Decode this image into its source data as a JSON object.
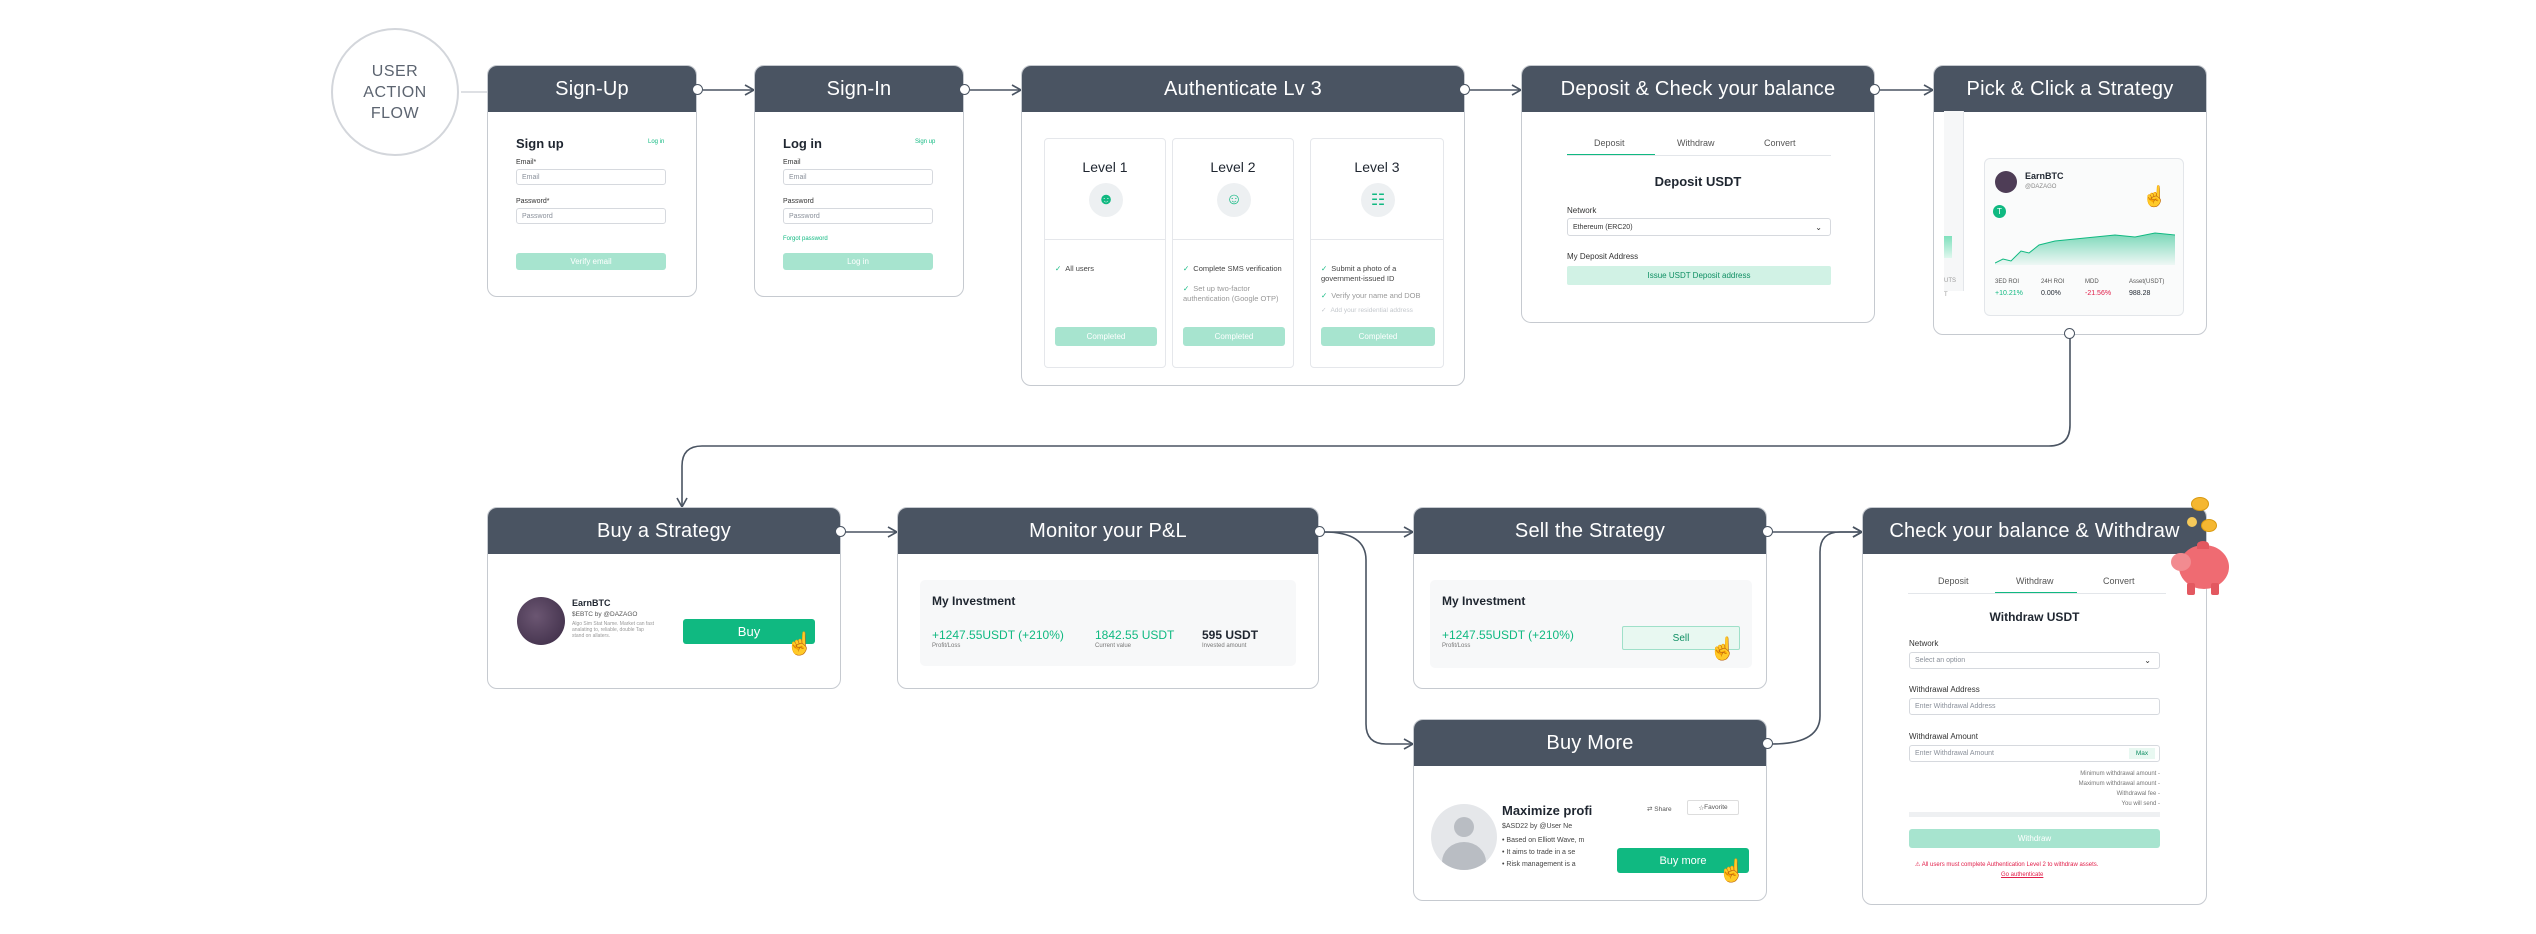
{
  "flow_label": [
    "USER",
    "ACTION",
    "FLOW"
  ],
  "colors": {
    "header": "#4a5462",
    "accent": "#10b981",
    "accent_pale": "#a7e4cf",
    "negative": "#e11d48",
    "arrow": "#4a5462"
  },
  "signup": {
    "header": "Sign-Up",
    "title": "Sign up",
    "login_link": "Log in",
    "email_label": "Email*",
    "email_placeholder": "Email",
    "password_label": "Password*",
    "password_placeholder": "Password",
    "button": "Verify email"
  },
  "signin": {
    "header": "Sign-In",
    "title": "Log in",
    "signup_link": "Sign up",
    "email_label": "Email",
    "email_placeholder": "Email",
    "password_label": "Password",
    "password_placeholder": "Password",
    "forgot": "Forgot password",
    "button": "Log in"
  },
  "authenticate": {
    "header": "Authenticate Lv 3",
    "levels": [
      {
        "title": "Level 1",
        "items": [
          "All users"
        ],
        "button": "Completed"
      },
      {
        "title": "Level 2",
        "items": [
          "Complete SMS verification",
          "Set up two-factor authentication (Google OTP)"
        ],
        "button": "Completed"
      },
      {
        "title": "Level  3",
        "items": [
          "Submit a photo of a government-issued ID",
          "Verify your name and DOB"
        ],
        "faded": "Add your residential address",
        "button": "Completed"
      }
    ]
  },
  "deposit": {
    "header": "Deposit & Check your balance",
    "tabs": [
      "Deposit",
      "Withdraw",
      "Convert"
    ],
    "title": "Deposit USDT",
    "network_label": "Network",
    "network_value": "Ethereum (ERC20)",
    "address_label": "My Deposit Address",
    "issue_button": "Issue USDT Deposit address"
  },
  "pick": {
    "header": "Pick & Click a Strategy",
    "name": "EarnBTC",
    "handle": "@DAZAGO",
    "badge": "T",
    "stats_labels": [
      "3ED ROI",
      "24H ROI",
      "MDD",
      "Asset(USDT)"
    ],
    "stats_values": [
      "+10.21%",
      "0.00%",
      "-21.56%",
      "988.28"
    ],
    "left_labels": [
      "UTS",
      "T"
    ]
  },
  "buy": {
    "header": "Buy a Strategy",
    "name": "EarnBTC",
    "sub": "$EBTC by @DAZAGO",
    "desc": "Algo Sim Stat Name. Market can fast analating to, reliable, double Tap stand on allaters.",
    "button": "Buy"
  },
  "monitor": {
    "header": "Monitor your P&L",
    "title": "My Investment",
    "pl_value": "+1247.55USDT (+210%)",
    "pl_label": "Profit/Loss",
    "current_value": "1842.55 USDT",
    "current_label": "Current value",
    "invested_value": "595 USDT",
    "invested_label": "Invested amount"
  },
  "sell": {
    "header": "Sell the Strategy",
    "title": "My Investment",
    "pl_value": "+1247.55USDT (+210%)",
    "pl_label": "Profit/Loss",
    "button": "Sell"
  },
  "buymore": {
    "header": "Buy More",
    "title": "Maximize profi",
    "sub": "$ASD22 by @User Ne",
    "bullets": [
      "Based on Elliott Wave, m",
      "It aims to trade in a se",
      "Risk management is a"
    ],
    "share": "Share",
    "favorite": "Favorite",
    "button": "Buy more"
  },
  "withdraw": {
    "header": "Check your balance & Withdraw",
    "tabs": [
      "Deposit",
      "Withdraw",
      "Convert"
    ],
    "title": "Withdraw USDT",
    "network_label": "Network",
    "network_placeholder": "Select an option",
    "address_label": "Withdrawal Address",
    "address_placeholder": "Enter Withdrawal Address",
    "amount_label": "Withdrawal Amount",
    "amount_placeholder": "Enter Withdrawal Amount",
    "max": "Max",
    "info": [
      "Minimum withdrawal amount -",
      "Maximum withdrawal amount -",
      "Withdrawal fee -",
      "You will send -"
    ],
    "button": "Withdraw",
    "warning": "All users must complete Authentication Level 2 to withdraw assets.",
    "warning_link": "Go authenticate"
  }
}
